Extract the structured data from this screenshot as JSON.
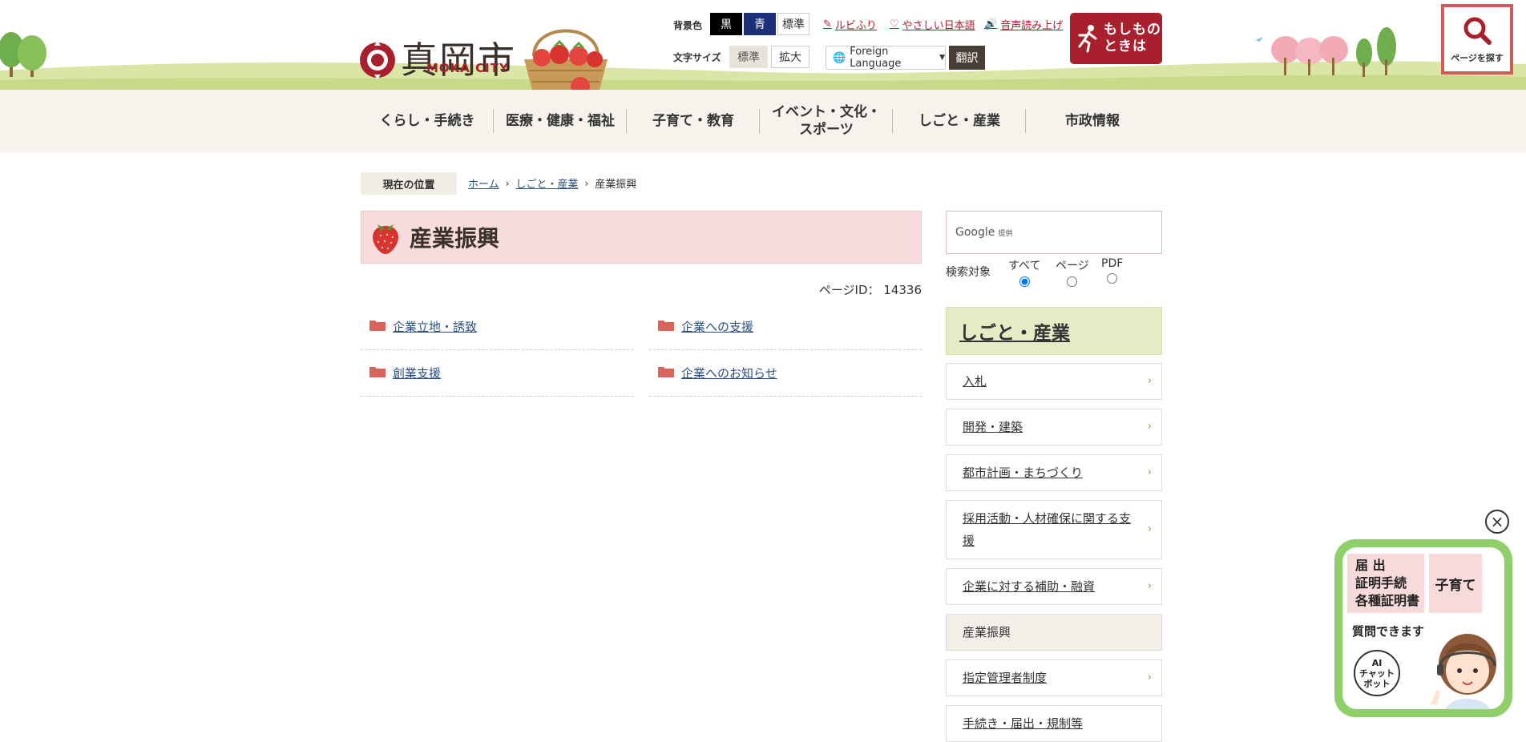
{
  "header": {
    "logo_text": "真岡市",
    "logo_sub": "MOKA CITY",
    "bg_color_label": "背景色",
    "bg_black": "黒",
    "bg_blue": "青",
    "bg_standard": "標準",
    "font_size_label": "文字サイズ",
    "font_standard": "標準",
    "font_large": "拡大",
    "ruby_link": "ルビふり",
    "easy_japanese_link": "やさしい日本語",
    "read_aloud_link": "音声読み上げ",
    "language_select": "Foreign Language",
    "translate_button": "翻訳",
    "emergency_line1": "もしもの",
    "emergency_line2": "ときは",
    "find_page_label": "ページを探す"
  },
  "nav": {
    "items": [
      {
        "label": "くらし・手続き"
      },
      {
        "label": "医療・健康・福祉"
      },
      {
        "label": "子育て・教育"
      },
      {
        "label_line1": "イベント・文化・",
        "label_line2": "スポーツ"
      },
      {
        "label": "しごと・産業"
      },
      {
        "label": "市政情報"
      }
    ]
  },
  "breadcrumb": {
    "label": "現在の位置",
    "items": [
      "ホーム",
      "しごと・産業",
      "産業振興"
    ]
  },
  "main": {
    "title": "産業振興",
    "page_id": "ページID： 14336",
    "categories": [
      "企業立地・誘致",
      "企業への支援",
      "創業支援",
      "企業へのお知らせ"
    ]
  },
  "sidebar": {
    "search_brand": "Google",
    "search_sub": "提供",
    "search_target_label": "検索対象",
    "search_options": [
      "すべて",
      "ページ",
      "PDF"
    ],
    "section_title": "しごと・産業",
    "items": [
      {
        "label": "入札"
      },
      {
        "label": "開発・建築"
      },
      {
        "label": "都市計画・まちづくり"
      },
      {
        "label": "採用活動・人材確保に関する支援"
      },
      {
        "label": "企業に対する補助・融資"
      },
      {
        "label": "産業振興"
      },
      {
        "label": "指定管理者制度"
      },
      {
        "label": "手続き・届出・規制等"
      }
    ]
  },
  "chatbot": {
    "tile1_line1": "届 出",
    "tile1_line2": "証明手続",
    "tile1_line3": "各種証明書",
    "tile2": "子育て",
    "ask": "質問できます",
    "badge_line1": "AI",
    "badge_line2": "チャット",
    "badge_line3": "ボット"
  },
  "colors": {
    "brand_red": "#a8202e",
    "nav_bg": "#f6f3ec",
    "title_bg": "#f6dcdc",
    "side_head_bg": "#e3ecc5",
    "chat_green": "#8fcf6a"
  }
}
